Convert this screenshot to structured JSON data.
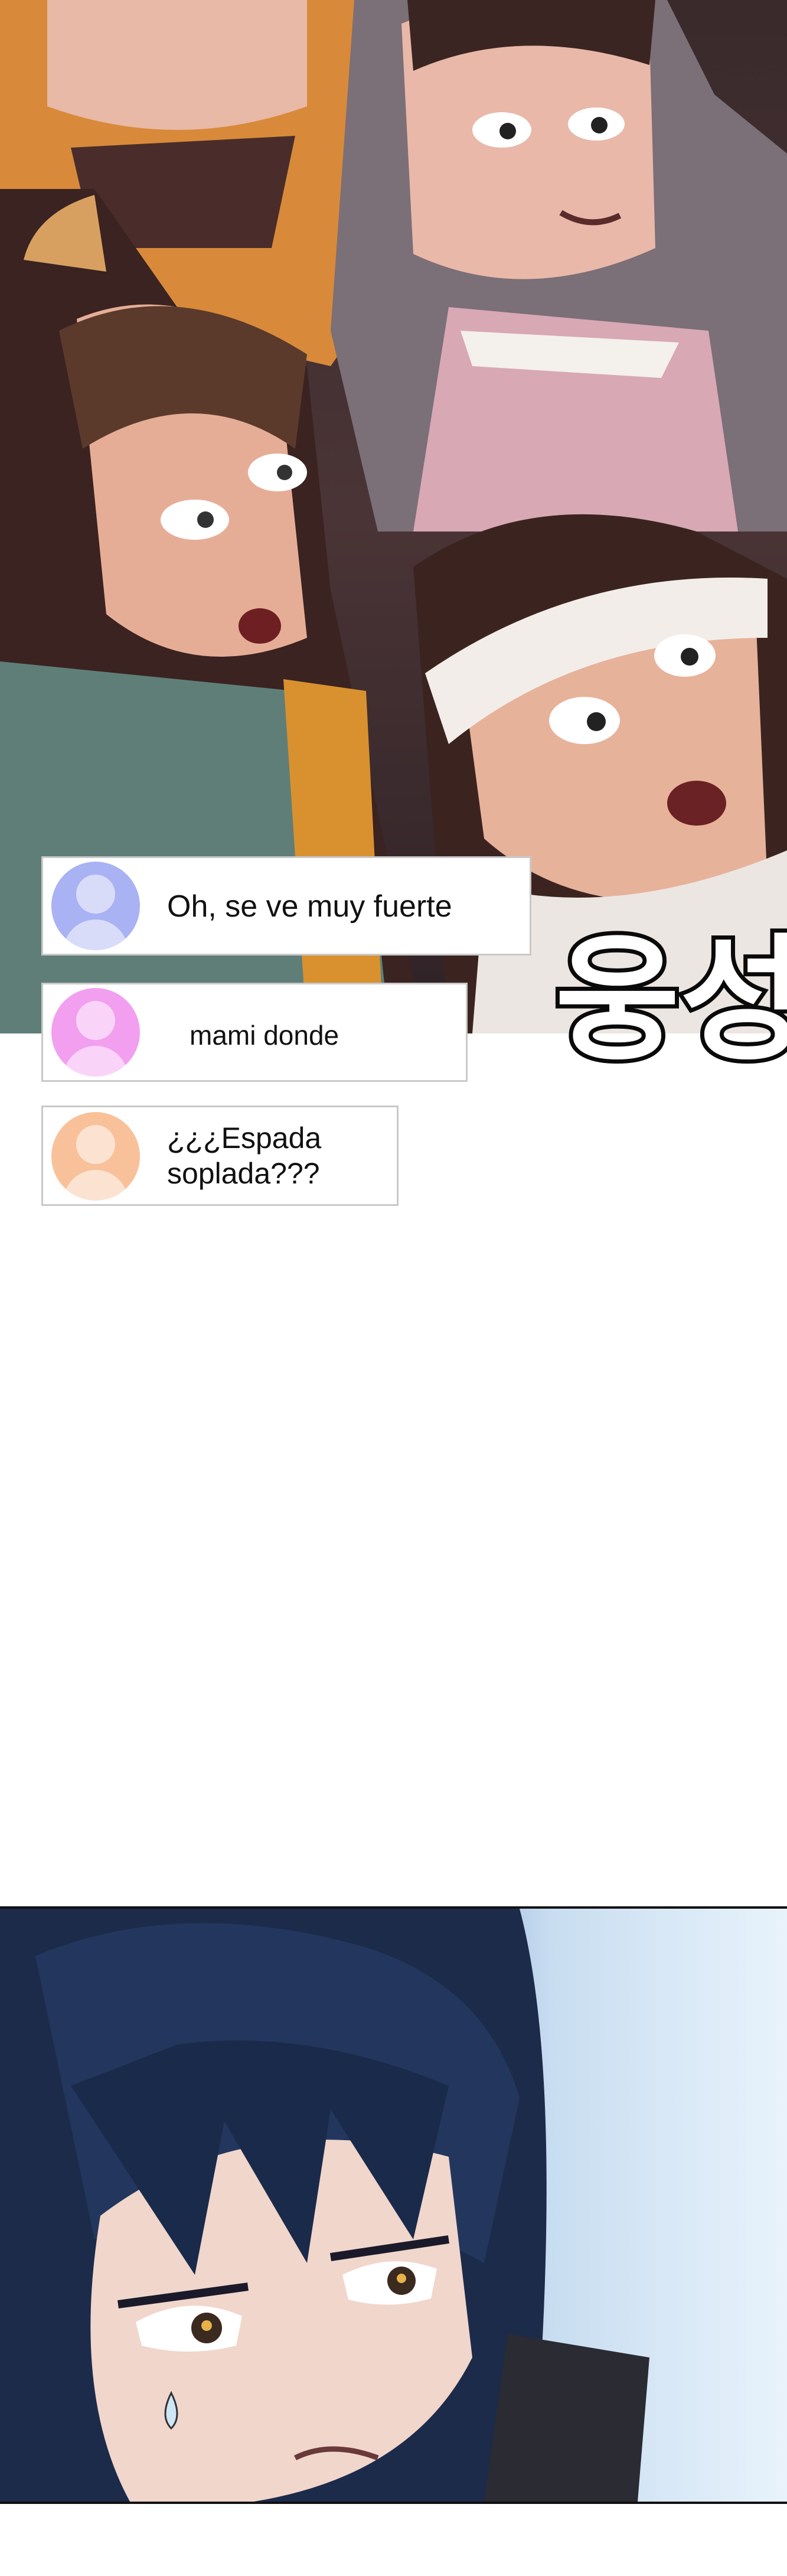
{
  "comments": [
    {
      "text": "Oh, se ve muy fuerte",
      "avatar_color": "#a9b2f2"
    },
    {
      "text": "mami donde",
      "avatar_color": "#f29ff0"
    },
    {
      "text": "¿¿¿Espada\nsoplada???",
      "avatar_color": "#f9c19a"
    }
  ],
  "sound_effect": "웅성",
  "colors": {
    "background": "#ffffff",
    "comment_border": "#c9c9c9"
  }
}
